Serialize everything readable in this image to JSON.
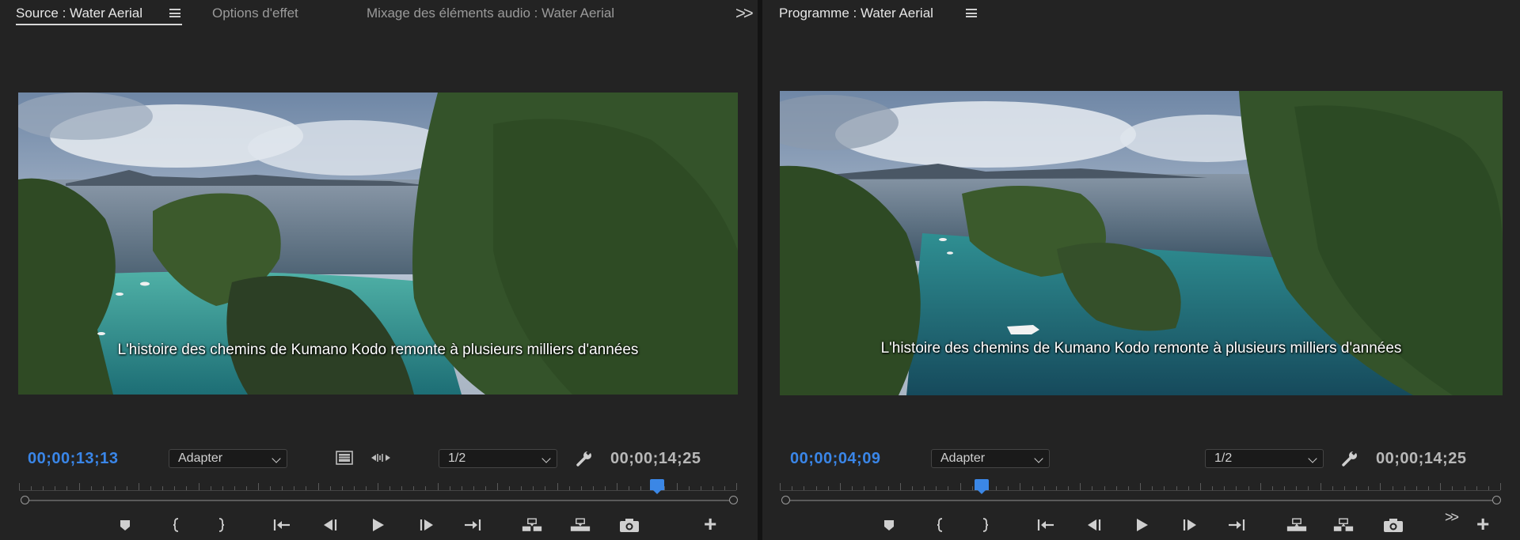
{
  "source": {
    "tabs": [
      {
        "label": "Source : Water Aerial",
        "active": true
      },
      {
        "label": "Options d'effet",
        "active": false
      },
      {
        "label": "Mixage des éléments audio : Water Aerial",
        "active": false
      }
    ],
    "overflow_icon": ">>",
    "subtitle": "L'histoire des chemins de Kumano Kodo remonte à plusieurs milliers d'années",
    "current_timecode": "00;00;13;13",
    "fit_select": "Adapter",
    "resolution_select": "1/2",
    "duration_timecode": "00;00;14;25",
    "playhead_position": 0.89,
    "transport_icons": [
      "add-marker-icon",
      "mark-in-icon",
      "mark-out-icon",
      "go-to-in-icon",
      "step-back-icon",
      "play-icon",
      "step-forward-icon",
      "go-to-out-icon",
      "insert-icon",
      "overwrite-icon",
      "export-frame-icon"
    ],
    "add_button": "+"
  },
  "program": {
    "tabs": [
      {
        "label": "Programme : Water Aerial",
        "active": true
      }
    ],
    "subtitle": "L'histoire des chemins de Kumano Kodo remonte à plusieurs milliers d'années",
    "current_timecode": "00;00;04;09",
    "fit_select": "Adapter",
    "resolution_select": "1/2",
    "duration_timecode": "00;00;14;25",
    "playhead_position": 0.28,
    "transport_icons": [
      "add-marker-icon",
      "mark-in-icon",
      "mark-out-icon",
      "go-to-in-icon",
      "step-back-icon",
      "play-icon",
      "step-forward-icon",
      "go-to-out-icon",
      "lift-icon",
      "extract-icon",
      "export-frame-icon"
    ],
    "overflow_icon": ">>",
    "add_button": "+"
  },
  "colors": {
    "accent_blue": "#3a86e8",
    "panel_bg": "#232323",
    "divider": "#131313"
  }
}
